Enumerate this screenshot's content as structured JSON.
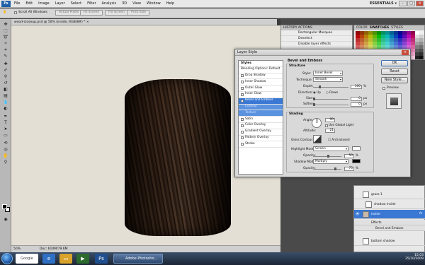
{
  "menubar": {
    "logo": "Ps",
    "items": [
      "File",
      "Edit",
      "Image",
      "Layer",
      "Select",
      "Filter",
      "Analysis",
      "3D",
      "View",
      "Window",
      "Help"
    ],
    "workspace": "ESSENTIALS ▾"
  },
  "options": {
    "scroll_all_windows": "Scroll All Windows",
    "buttons": [
      "Actual Pixels",
      "Fit Screen",
      "Fill Screen",
      "Print Size"
    ]
  },
  "document": {
    "tab": "wood-closeup.psd @ 50% (inside, RGB/8#) * ×",
    "zoom": "50%",
    "doc_info": "Doc: 610M/79.6M"
  },
  "history": {
    "tabs": "HISTORY  ACTIONS",
    "rows": [
      "Rectangular Marquee",
      "Deselect",
      "Disable layer effects"
    ]
  },
  "swatches": {
    "tabs": [
      "COLOR",
      "SWATCHES",
      "STYLES"
    ]
  },
  "dialog": {
    "title": "Layer Style",
    "left_items": [
      "Styles",
      "Blending Options: Default",
      "Drop Shadow",
      "Inner Shadow",
      "Outer Glow",
      "Inner Glow",
      "Bevel and Emboss",
      "Contour",
      "Texture",
      "Satin",
      "Color Overlay",
      "Gradient Overlay",
      "Pattern Overlay",
      "Stroke"
    ],
    "section_title": "Bevel and Emboss",
    "structure": {
      "label": "Structure",
      "style_label": "Style:",
      "style_value": "Inner Bevel",
      "technique_label": "Technique:",
      "technique_value": "Smooth",
      "depth_label": "Depth:",
      "depth_value": "100",
      "depth_unit": "%",
      "direction_label": "Direction:",
      "direction_up": "Up",
      "direction_down": "Down",
      "size_label": "Size:",
      "size_value": "0",
      "size_unit": "px",
      "soften_label": "Soften:",
      "soften_value": "0",
      "soften_unit": "px"
    },
    "shading": {
      "label": "Shading",
      "angle_label": "Angle:",
      "angle_value": "90",
      "use_global_light": "Use Global Light",
      "altitude_label": "Altitude:",
      "altitude_value": "21",
      "gloss_label": "Gloss Contour:",
      "antialiased": "Anti-aliased",
      "highlight_label": "Highlight Mode:",
      "highlight_value": "Screen",
      "opacity1_label": "Opacity:",
      "opacity1_value": "50",
      "shadow_label": "Shadow Mode:",
      "shadow_value": "Multiply",
      "opacity2_label": "Opacity:",
      "opacity2_value": "75",
      "pct": "%"
    },
    "buttons": {
      "ok": "OK",
      "reset": "Reset",
      "new_style": "New Style...",
      "preview": "Preview"
    }
  },
  "layers": {
    "rows": [
      "grass 1",
      "shadow inside",
      "inside",
      "Effects",
      "Bevel and Emboss",
      "bottom shadow"
    ]
  },
  "taskbar": {
    "task": "Adobe Photosho...",
    "time": "15:03",
    "date": "25/10/2009",
    "google": "Google"
  }
}
